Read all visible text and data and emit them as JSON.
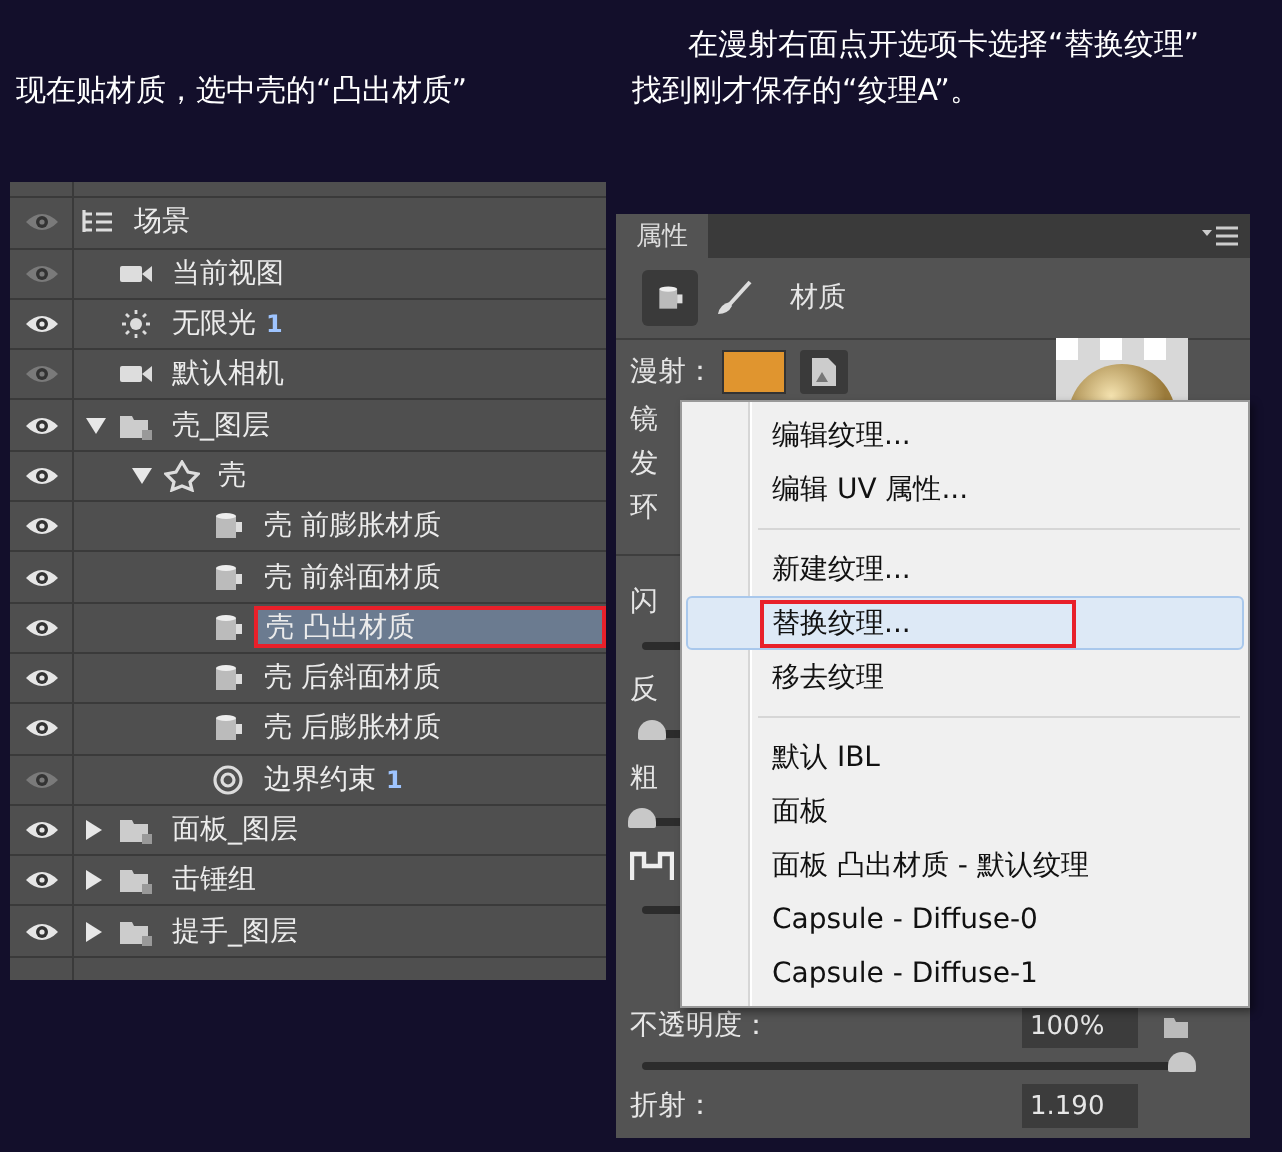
{
  "captions": {
    "left": "现在贴材质，选中壳的“凸出材质”",
    "right": [
      "在漫射右面点开选项卡选择“替换纹理”",
      "找到刚才保存的“纹理A”。"
    ]
  },
  "layers": [
    {
      "label": "场景",
      "kind": "scene",
      "visible": false,
      "selected": false,
      "marked": false,
      "children": [
        {
          "label": "当前视图",
          "kind": "camera",
          "visible": false,
          "selected": false,
          "marked": false
        },
        {
          "label": "无限光",
          "count": "1",
          "kind": "light",
          "visible": true,
          "selected": false,
          "marked": false
        },
        {
          "label": "默认相机",
          "kind": "camera",
          "visible": false,
          "selected": false,
          "marked": false
        },
        {
          "label": "壳_图层",
          "kind": "folder",
          "expanded": true,
          "visible": true,
          "selected": false,
          "marked": false,
          "children": [
            {
              "label": "壳",
              "kind": "mesh",
              "expanded": true,
              "visible": true,
              "selected": false,
              "marked": false,
              "children": [
                {
                  "label": "壳 前膨胀材质",
                  "kind": "material",
                  "visible": true,
                  "selected": false,
                  "marked": false
                },
                {
                  "label": "壳 前斜面材质",
                  "kind": "material",
                  "visible": true,
                  "selected": false,
                  "marked": false
                },
                {
                  "label": "壳 凸出材质",
                  "kind": "material",
                  "visible": true,
                  "selected": true,
                  "marked": true
                },
                {
                  "label": "壳 后斜面材质",
                  "kind": "material",
                  "visible": true,
                  "selected": false,
                  "marked": false
                },
                {
                  "label": "壳 后膨胀材质",
                  "kind": "material",
                  "visible": true,
                  "selected": false,
                  "marked": false
                },
                {
                  "label": "边界约束",
                  "count": "1",
                  "kind": "constraint",
                  "visible": false,
                  "selected": false,
                  "marked": false
                }
              ]
            }
          ]
        },
        {
          "label": "面板_图层",
          "kind": "folder",
          "expanded": false,
          "visible": true,
          "selected": false,
          "marked": false
        },
        {
          "label": "击锤组",
          "kind": "folder",
          "expanded": false,
          "visible": true,
          "selected": false,
          "marked": false
        },
        {
          "label": "提手_图层",
          "kind": "folder",
          "expanded": false,
          "visible": true,
          "selected": false,
          "marked": false
        }
      ]
    }
  ],
  "properties": {
    "tab": "属性",
    "section": "材质",
    "diffuse_label": "漫射：",
    "rows": [
      {
        "kind": "label",
        "label": "镜"
      },
      {
        "kind": "label",
        "label": "发"
      },
      {
        "kind": "label",
        "label": "环"
      },
      {
        "kind": "divider"
      },
      {
        "kind": "label",
        "label": "闪"
      },
      {
        "kind": "track"
      },
      {
        "kind": "label",
        "label": "反"
      },
      {
        "kind": "slider",
        "level": 0.02
      },
      {
        "kind": "label",
        "label": "粗"
      },
      {
        "kind": "slider",
        "level": 0.0
      },
      {
        "kind": "bump"
      },
      {
        "kind": "track"
      }
    ],
    "opacity": {
      "label": "不透明度：",
      "value": "100%",
      "level": 1
    },
    "refraction": {
      "label": "折射：",
      "value": "1.190"
    }
  },
  "menu": [
    [
      {
        "label": "编辑纹理...",
        "hovered": false,
        "marked": false
      },
      {
        "label": "编辑 UV 属性...",
        "hovered": false,
        "marked": false
      }
    ],
    [
      {
        "label": "新建纹理...",
        "hovered": false,
        "marked": false
      },
      {
        "label": "替换纹理...",
        "hovered": true,
        "marked": true
      },
      {
        "label": "移去纹理",
        "hovered": false,
        "marked": false
      }
    ],
    [
      {
        "label": "默认 IBL",
        "hovered": false,
        "marked": false
      },
      {
        "label": "面板",
        "hovered": false,
        "marked": false
      },
      {
        "label": "面板 凸出材质 - 默认纹理",
        "hovered": false,
        "marked": false
      },
      {
        "label": "Capsule - Diffuse-0",
        "hovered": false,
        "marked": false
      },
      {
        "label": "Capsule - Diffuse-1",
        "hovered": false,
        "marked": false
      }
    ]
  ]
}
